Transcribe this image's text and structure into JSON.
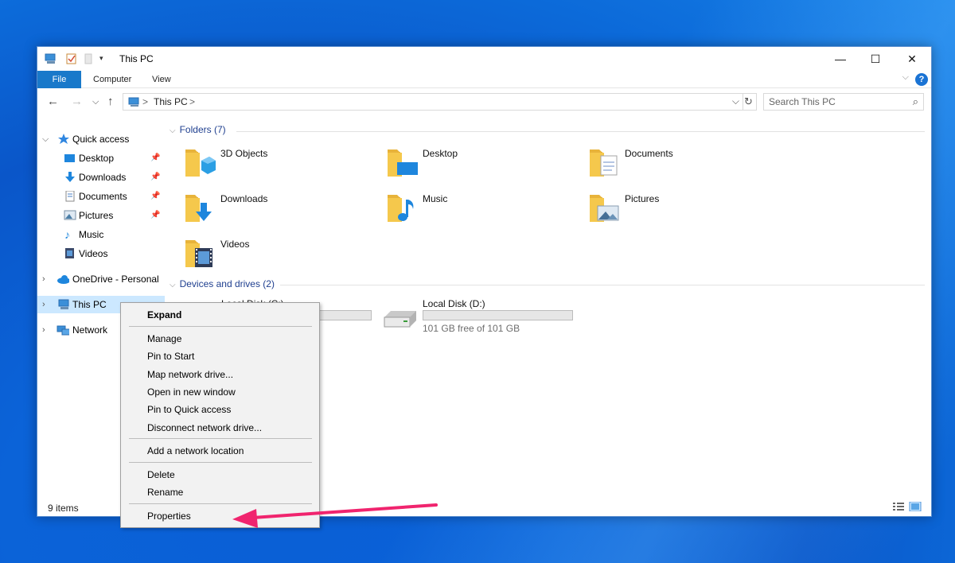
{
  "window": {
    "title": "This PC",
    "controls": {
      "minimize": "—",
      "maximize": "☐",
      "close": "✕"
    }
  },
  "ribbon": {
    "tabs": [
      {
        "label": "File"
      },
      {
        "label": "Computer"
      },
      {
        "label": "View"
      }
    ],
    "help": "?"
  },
  "address": {
    "crumbs": [
      "This PC"
    ],
    "separator": ">",
    "search_placeholder": "Search This PC"
  },
  "nav": {
    "items": [
      {
        "label": "Quick access",
        "icon": "star-icon"
      },
      {
        "label": "Desktop",
        "icon": "desktop-icon",
        "pinned": true
      },
      {
        "label": "Downloads",
        "icon": "download-icon",
        "pinned": true
      },
      {
        "label": "Documents",
        "icon": "document-icon",
        "pinned": true
      },
      {
        "label": "Pictures",
        "icon": "picture-icon",
        "pinned": true
      },
      {
        "label": "Music",
        "icon": "music-icon"
      },
      {
        "label": "Videos",
        "icon": "video-icon"
      },
      {
        "label": "OneDrive - Personal",
        "icon": "cloud-icon"
      },
      {
        "label": "This PC",
        "icon": "computer-icon",
        "selected": true
      },
      {
        "label": "Network",
        "icon": "network-icon"
      }
    ]
  },
  "content": {
    "folders_header": "Folders (7)",
    "folders": [
      {
        "name": "3D Objects",
        "icon": "3d-objects-folder-icon"
      },
      {
        "name": "Desktop",
        "icon": "desktop-folder-icon"
      },
      {
        "name": "Documents",
        "icon": "documents-folder-icon"
      },
      {
        "name": "Downloads",
        "icon": "downloads-folder-icon"
      },
      {
        "name": "Music",
        "icon": "music-folder-icon"
      },
      {
        "name": "Pictures",
        "icon": "pictures-folder-icon"
      },
      {
        "name": "Videos",
        "icon": "videos-folder-icon"
      }
    ],
    "drives_header": "Devices and drives (2)",
    "drives": [
      {
        "name": "Local Disk (C:)",
        "icon": "windows-drive-icon"
      },
      {
        "name": "Local Disk (D:)",
        "icon": "hard-drive-icon",
        "free_text": "101 GB free of 101 GB",
        "used_fraction": 0.0
      }
    ]
  },
  "status": {
    "items": "9 items"
  },
  "context_menu": {
    "items": [
      {
        "label": "Expand",
        "bold": true
      },
      {
        "label": "Manage"
      },
      {
        "label": "Pin to Start"
      },
      {
        "label": "Map network drive..."
      },
      {
        "label": "Open in new window"
      },
      {
        "label": "Pin to Quick access"
      },
      {
        "label": "Disconnect network drive..."
      },
      {
        "label": "Add a network location"
      },
      {
        "label": "Delete"
      },
      {
        "label": "Rename"
      },
      {
        "label": "Properties"
      }
    ]
  },
  "colors": {
    "accent": "#1979ca",
    "selection": "#cce8ff",
    "annotation_arrow": "#f0246e",
    "folder_yellow": "#f5c84c"
  }
}
